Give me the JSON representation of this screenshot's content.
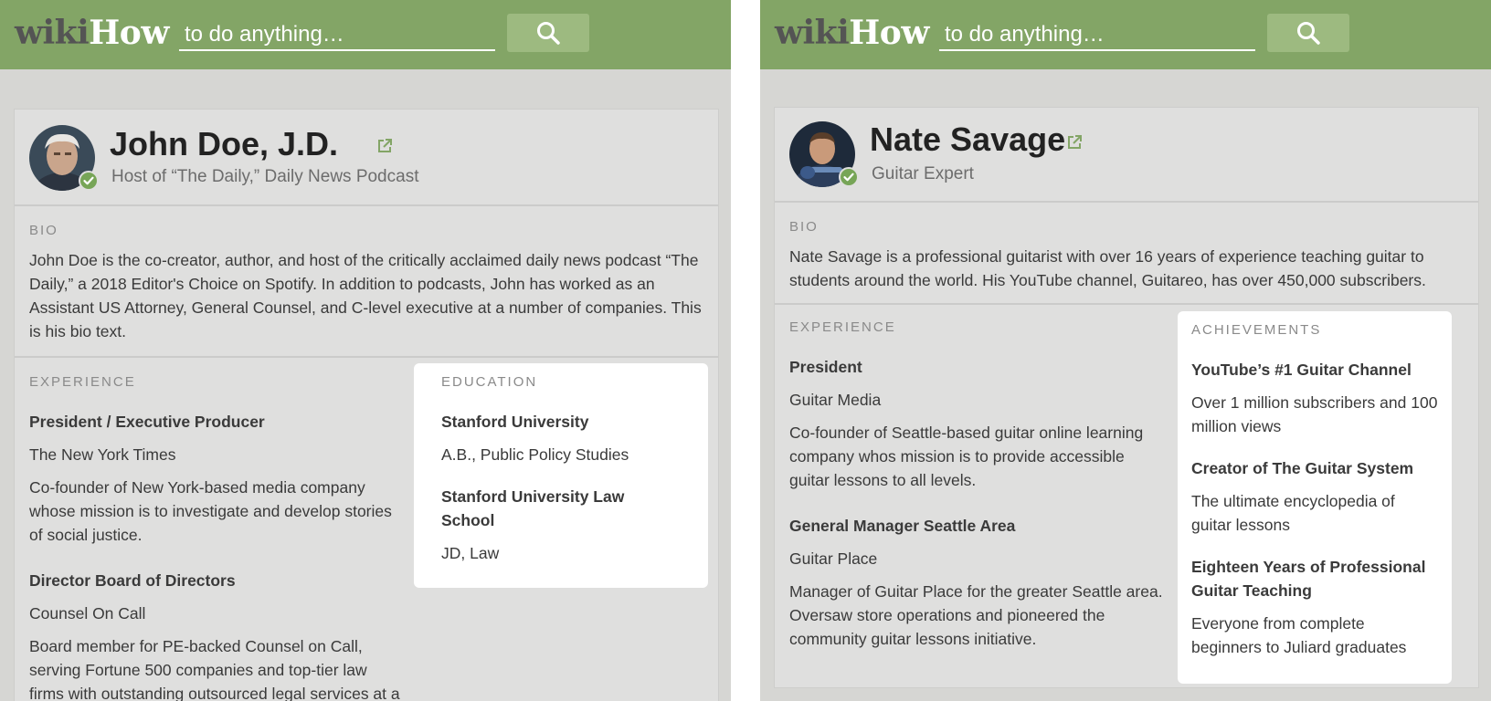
{
  "left_panel": {
    "header": {
      "logo_wiki": "wiki",
      "logo_how": "How",
      "search_placeholder": "to do anything…",
      "search_icon": "magnifier-icon"
    },
    "profile": {
      "name": "John Doe, J.D.",
      "subtitle": "Host of “The Daily,” Daily News Podcast",
      "verified_icon": "check-badge-icon",
      "external_icon": "external-link-icon"
    },
    "bio": {
      "label": "BIO",
      "text": "John Doe is the co-creator, author, and host of the critically acclaimed daily news podcast “The Daily,” a 2018 Editor's Choice on Spotify. In addition to podcasts, John has worked as an Assistant US Attorney, General Counsel, and C-level executive at a number of companies. This is his bio text."
    },
    "experience": {
      "label": "EXPERIENCE",
      "items": [
        {
          "title": "President / Executive Producer",
          "org": "The New York Times",
          "description": "Co-founder of New York-based media company whose mission is to investigate and develop stories of social justice."
        },
        {
          "title": "Director Board of Directors",
          "org": "Counsel On Call",
          "description": "Board member for PE-backed Counsel on Call, serving Fortune 500 companies and top-tier law firms with outstanding outsourced legal services at a"
        }
      ]
    },
    "education": {
      "label": "EDUCATION",
      "items": [
        {
          "school": "Stanford University",
          "degree": "A.B., Public Policy Studies"
        },
        {
          "school": "Stanford University Law School",
          "degree": "JD, Law"
        }
      ]
    }
  },
  "right_panel": {
    "header": {
      "logo_wiki": "wiki",
      "logo_how": "How",
      "search_placeholder": "to do anything…",
      "search_icon": "magnifier-icon"
    },
    "profile": {
      "name": "Nate Savage",
      "subtitle": "Guitar Expert",
      "verified_icon": "check-badge-icon",
      "external_icon": "external-link-icon"
    },
    "bio": {
      "label": "BIO",
      "text": "Nate Savage is a professional guitarist with over 16 years of experience teaching guitar to students around the world. His YouTube channel, Guitareo, has over 450,000 subscribers."
    },
    "experience": {
      "label": "EXPERIENCE",
      "items": [
        {
          "title": "President",
          "org": "Guitar Media",
          "description": "Co-founder of Seattle-based guitar online learning company whos mission is to provide accessible guitar lessons to all levels."
        },
        {
          "title": "General Manager Seattle Area",
          "org": "Guitar Place",
          "description": "Manager of Guitar Place for the greater Seattle area. Oversaw store operations and pioneered the community guitar lessons initiative."
        }
      ]
    },
    "achievements": {
      "label": "ACHIEVEMENTS",
      "items": [
        {
          "title": "YouTube’s #1 Guitar Channel",
          "description": "Over 1 million subscribers and 100 million views"
        },
        {
          "title": "Creator of The Guitar System",
          "description": "The ultimate encyclopedia of guitar lessons"
        },
        {
          "title": "Eighteen Years of Professional Guitar Teaching",
          "description": "Everyone from complete beginners to Juliard graduates"
        }
      ]
    }
  },
  "colors": {
    "header_green": "#83a566",
    "search_button": "#9dba80",
    "verified_green": "#77a557",
    "page_bg": "#d6d6d3",
    "card_bg": "#dfdfde"
  }
}
